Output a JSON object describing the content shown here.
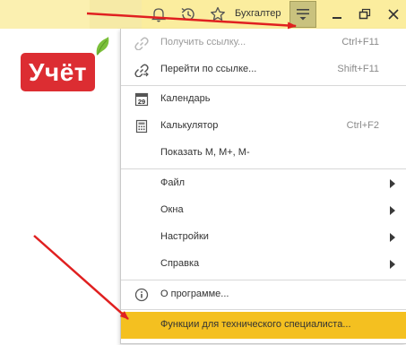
{
  "header": {
    "user": "Бухгалтер",
    "icons": [
      "bell-icon",
      "history-icon",
      "star-icon",
      "menu-icon",
      "minimize-icon",
      "restore-icon",
      "close-icon"
    ]
  },
  "logo": {
    "text": "Учёт"
  },
  "menu": {
    "items": [
      {
        "label": "Получить ссылку...",
        "shortcut": "Ctrl+F11",
        "icon": "link-icon",
        "disabled": true
      },
      {
        "label": "Перейти по ссылке...",
        "shortcut": "Shift+F11",
        "icon": "go-to-link-icon"
      },
      {
        "label": "Календарь",
        "icon": "calendar-icon",
        "icon_text": "29"
      },
      {
        "label": "Калькулятор",
        "shortcut": "Ctrl+F2",
        "icon": "calculator-icon"
      },
      {
        "label": "Показать М, М+, М-"
      },
      {
        "label": "Файл",
        "submenu": true
      },
      {
        "label": "Окна",
        "submenu": true
      },
      {
        "label": "Настройки",
        "submenu": true
      },
      {
        "label": "Справка",
        "submenu": true
      },
      {
        "label": "О программе...",
        "icon": "info-icon"
      },
      {
        "label": "Функции для технического специалиста...",
        "highlighted": true
      }
    ]
  },
  "colors": {
    "header_bg": "#fbed9e",
    "highlight": "#f4c020",
    "logo_bg": "#dc2d32",
    "annotation_arrow": "#e02020"
  }
}
